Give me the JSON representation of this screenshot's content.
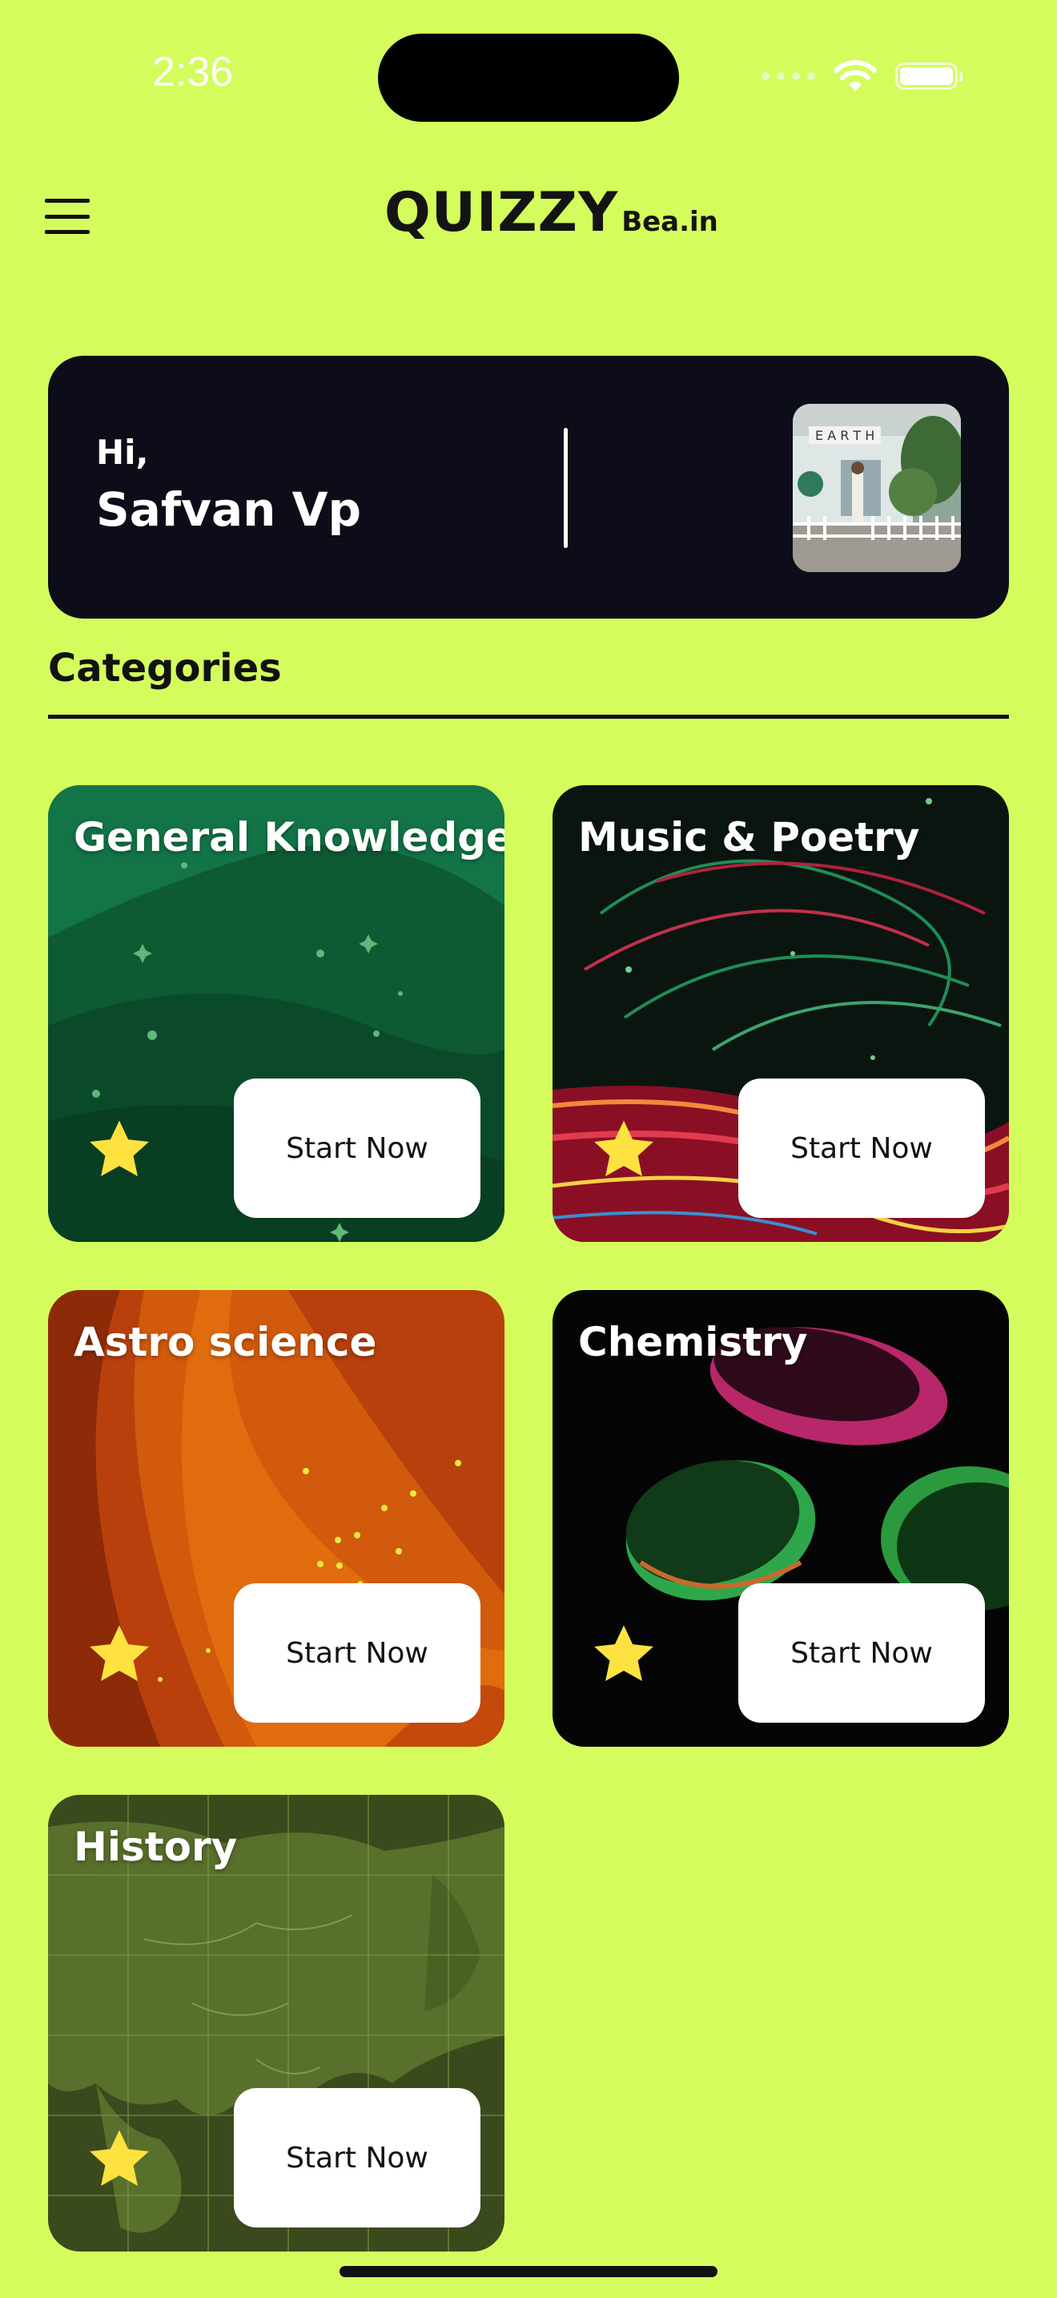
{
  "status_bar": {
    "time": "2:36"
  },
  "header": {
    "logo_main": "QUIZZY",
    "logo_sub": "Bea.in"
  },
  "greeting": {
    "hi": "Hi,",
    "name": "Safvan Vp"
  },
  "section": {
    "title": "Categories"
  },
  "categories": [
    {
      "title": "General Knowledge",
      "button": "Start Now"
    },
    {
      "title": "Music & Poetry",
      "button": "Start Now"
    },
    {
      "title": "Astro science",
      "button": "Start Now"
    },
    {
      "title": "Chemistry",
      "button": "Start Now"
    },
    {
      "title": "History",
      "button": "Start Now"
    }
  ],
  "colors": {
    "background": "#d4fc5c",
    "card_dark": "#0c0d19",
    "star": "#ffe23f"
  }
}
